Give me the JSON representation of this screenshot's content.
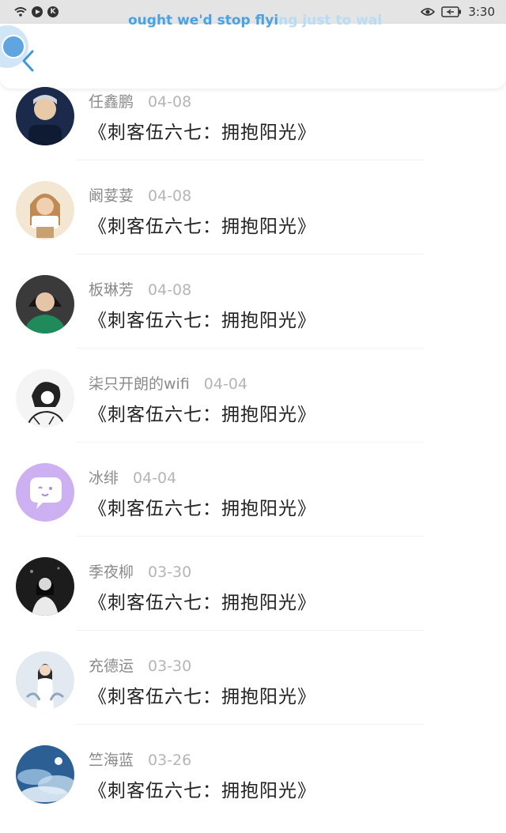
{
  "status_bar": {
    "time": "3:30",
    "lyric_main": "ought we'd stop flyi",
    "lyric_fade": "ng just to walk this o"
  },
  "header": {
    "back_icon": "chevron-left-icon"
  },
  "floating_ball": {
    "icon": "close-icon"
  },
  "comments": [
    {
      "name": "任鑫鹏",
      "date": "04-08",
      "work": "《刺客伍六七：拥抱阳光》",
      "avatar_color": "#1b2a4a"
    },
    {
      "name": "阚荽荽",
      "date": "04-08",
      "work": "《刺客伍六七：拥抱阳光》",
      "avatar_color": "#e9cfa0"
    },
    {
      "name": "板琳芳",
      "date": "04-08",
      "work": "《刺客伍六七：拥抱阳光》",
      "avatar_color": "#1f8a5a"
    },
    {
      "name": "柒只开朗的wifi",
      "date": "04-04",
      "work": "《刺客伍六七：拥抱阳光》",
      "avatar_color": "#f2f2f2"
    },
    {
      "name": "冰绯",
      "date": "04-04",
      "work": "《刺客伍六七：拥抱阳光》",
      "avatar_color": "#c9a8ef"
    },
    {
      "name": "季夜柳",
      "date": "03-30",
      "work": "《刺客伍六七：拥抱阳光》",
      "avatar_color": "#2a2a2a"
    },
    {
      "name": "充德运",
      "date": "03-30",
      "work": "《刺客伍六七：拥抱阳光》",
      "avatar_color": "#dfe6ee"
    },
    {
      "name": "竺海蓝",
      "date": "03-26",
      "work": "《刺客伍六七：拥抱阳光》",
      "avatar_color": "#2c5f93"
    }
  ]
}
